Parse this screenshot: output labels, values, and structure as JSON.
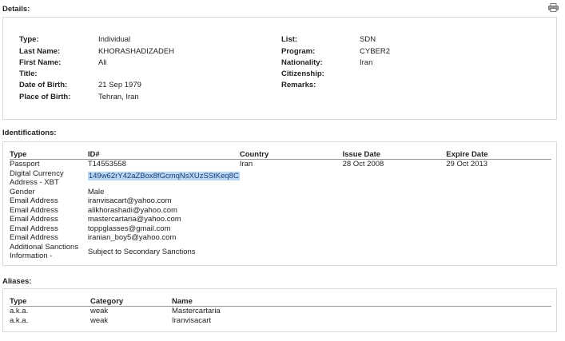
{
  "details": {
    "title": "Details:",
    "rows_left": [
      {
        "label": "Type:",
        "value": "Individual"
      },
      {
        "label": "Last Name:",
        "value": "KHORASHADIZADEH"
      },
      {
        "label": "First Name:",
        "value": "Ali"
      },
      {
        "label": "Title:",
        "value": ""
      },
      {
        "label": "Date of Birth:",
        "value": "21 Sep 1979"
      },
      {
        "label": "Place of Birth:",
        "value": "Tehran, Iran"
      }
    ],
    "rows_right": [
      {
        "label": "List:",
        "value": "SDN"
      },
      {
        "label": "Program:",
        "value": "CYBER2"
      },
      {
        "label": "Nationality:",
        "value": "Iran"
      },
      {
        "label": "Citizenship:",
        "value": ""
      },
      {
        "label": "Remarks:",
        "value": ""
      }
    ]
  },
  "identifications": {
    "title": "Identifications:",
    "headers": [
      "Type",
      "ID#",
      "Country",
      "Issue Date",
      "Expire Date"
    ],
    "rows": [
      [
        "Passport",
        "T14553558",
        "Iran",
        "28 Oct 2008",
        "29 Oct 2013"
      ],
      [
        "Digital Currency Address - XBT",
        "149w62rY42aZBox8fGcmqNsXUzSStKeq8C",
        "",
        "",
        ""
      ],
      [
        "Gender",
        "Male",
        "",
        "",
        ""
      ],
      [
        "Email Address",
        "iranvisacart@yahoo.com",
        "",
        "",
        ""
      ],
      [
        "Email Address",
        "alikhorashadi@yahoo.com",
        "",
        "",
        ""
      ],
      [
        "Email Address",
        "mastercartaria@yahoo.com",
        "",
        "",
        ""
      ],
      [
        "Email Address",
        "toppglasses@gmail.com",
        "",
        "",
        ""
      ],
      [
        "Email Address",
        "iranian_boy5@yahoo.com",
        "",
        "",
        ""
      ],
      [
        "Additional Sanctions Information -",
        "Subject to Secondary Sanctions",
        "",
        "",
        ""
      ]
    ]
  },
  "aliases": {
    "title": "Aliases:",
    "headers": [
      "Type",
      "Category",
      "Name"
    ],
    "rows": [
      [
        "a.k.a.",
        "weak",
        "Mastercartaria"
      ],
      [
        "a.k.a.",
        "weak",
        "Iranvisacart"
      ]
    ]
  },
  "icons": {
    "print": "printer-icon"
  }
}
